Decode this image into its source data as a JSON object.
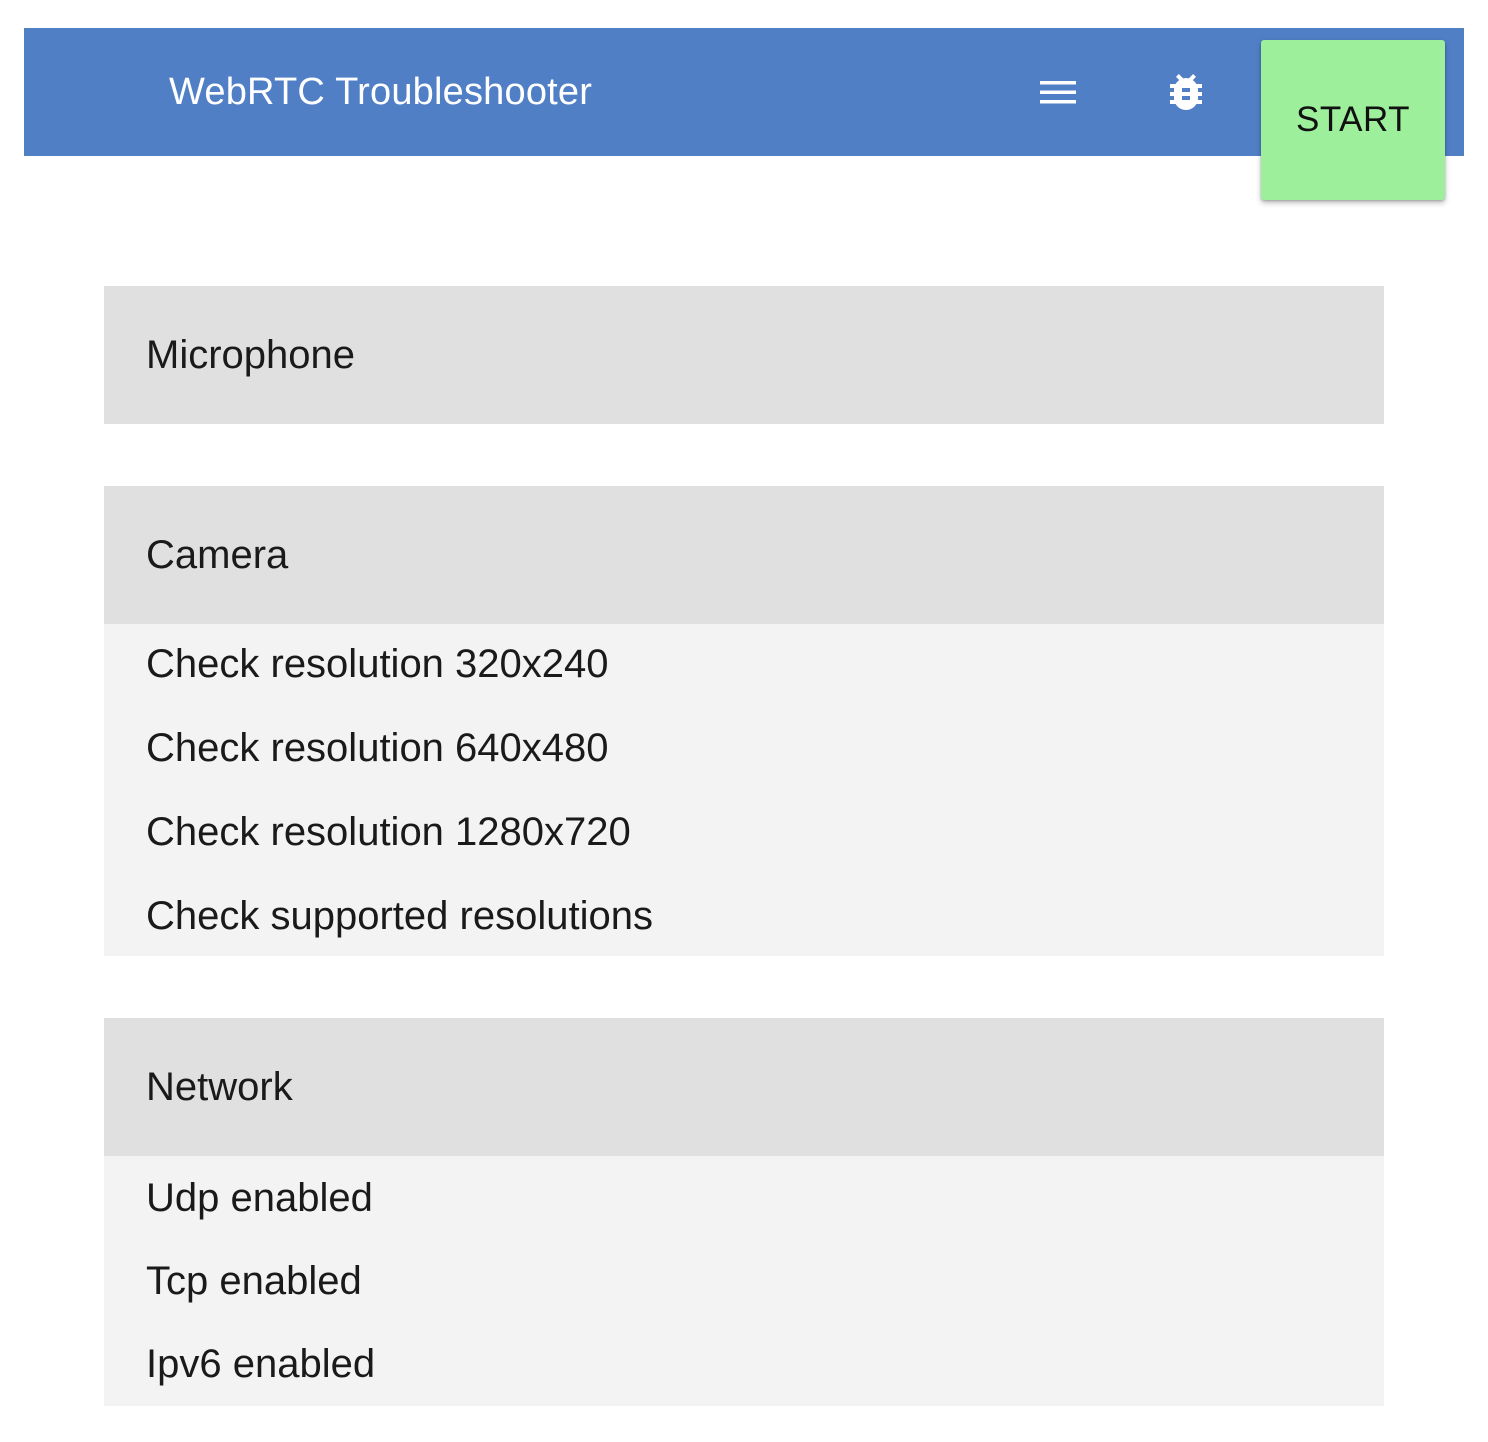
{
  "toolbar": {
    "title": "WebRTC Troubleshooter",
    "menu_icon": "hamburger-menu-icon",
    "debug_icon": "bug-icon",
    "start_label": "START",
    "background_color": "#517fc6",
    "start_color": "#9def9b"
  },
  "suites": [
    {
      "name": "Microphone",
      "tests": []
    },
    {
      "name": "Camera",
      "tests": [
        "Check resolution 320x240",
        "Check resolution 640x480",
        "Check resolution 1280x720",
        "Check supported resolutions"
      ]
    },
    {
      "name": "Network",
      "tests": [
        "Udp enabled",
        "Tcp enabled",
        "Ipv6 enabled"
      ]
    }
  ]
}
